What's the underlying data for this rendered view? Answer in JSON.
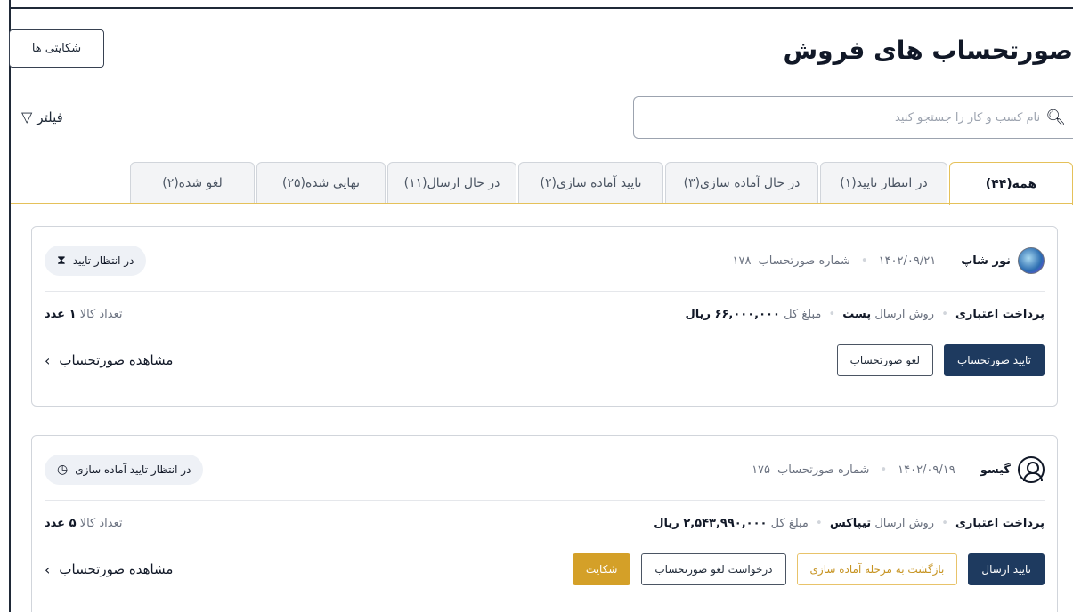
{
  "header": {
    "title": "صورتحساب های فروش",
    "complaints_button": "شکایتی ها"
  },
  "search": {
    "placeholder": "نام کسب و کار را جستجو کنید",
    "value": ""
  },
  "filter": {
    "label": "فیلتر"
  },
  "tabs": [
    {
      "label": "همه(۴۴)",
      "active": true
    },
    {
      "label": "در انتظار تایید(۱)",
      "active": false
    },
    {
      "label": "در حال آماده سازی(۳)",
      "active": false
    },
    {
      "label": "تایید آماده سازی(۲)",
      "active": false
    },
    {
      "label": "در حال ارسال(۱۱)",
      "active": false
    },
    {
      "label": "نهایی شده(۲۵)",
      "active": false
    },
    {
      "label": "لغو شده(۲)",
      "active": false
    }
  ],
  "invoices": [
    {
      "shop_name": "نور شاپ",
      "date": "۱۴۰۲/۰۹/۲۱",
      "invoice_number_label": "شماره صورتحساب",
      "invoice_number": "۱۷۸",
      "status": "در انتظار تایید",
      "payment": "پرداخت اعتباری",
      "shipping_label": "روش ارسال",
      "shipping": "پست",
      "total_label": "مبلغ کل",
      "total": "۶۶,۰۰۰,۰۰۰ ریال",
      "qty_label": "تعداد کالا",
      "qty": "۱ عدد",
      "actions": [
        "تایید صورتحساب",
        "لغو صورتحساب"
      ],
      "view_link": "مشاهده صورتحساب"
    },
    {
      "shop_name": "گیسو",
      "date": "۱۴۰۲/۰۹/۱۹",
      "invoice_number_label": "شماره صورتحساب",
      "invoice_number": "۱۷۵",
      "status": "در انتظار تایید آماده سازی",
      "payment": "پرداخت اعتباری",
      "shipping_label": "روش ارسال",
      "shipping": "تیپاکس",
      "total_label": "مبلغ کل",
      "total": "۲,۵۴۳,۹۹۰,۰۰۰ ریال",
      "qty_label": "تعداد کالا",
      "qty": "۵ عدد",
      "actions": [
        "تایید ارسال",
        "بازگشت به مرحله آماده سازی",
        "درخواست لغو صورتحساب",
        "شکایت"
      ],
      "view_link": "مشاهده صورتحساب"
    }
  ]
}
